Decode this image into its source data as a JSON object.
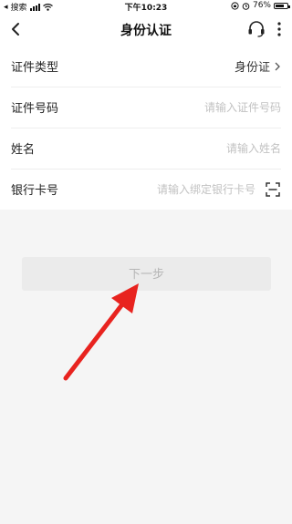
{
  "status_bar": {
    "back_app": "搜索",
    "time": "下午10:23",
    "battery": "76%",
    "battery_level": 0.76
  },
  "nav": {
    "title": "身份认证"
  },
  "form": {
    "rows": [
      {
        "label": "证件类型",
        "value": "身份证"
      },
      {
        "label": "证件号码",
        "placeholder": "请输入证件号码"
      },
      {
        "label": "姓名",
        "placeholder": "请输入姓名"
      },
      {
        "label": "银行卡号",
        "placeholder": "请输入绑定银行卡号"
      }
    ]
  },
  "actions": {
    "next_label": "下一步"
  },
  "colors": {
    "annotation_arrow": "#e8231f",
    "button_bg": "#ebebeb",
    "button_text": "#b5b5b5",
    "placeholder": "#c2c2c2"
  }
}
